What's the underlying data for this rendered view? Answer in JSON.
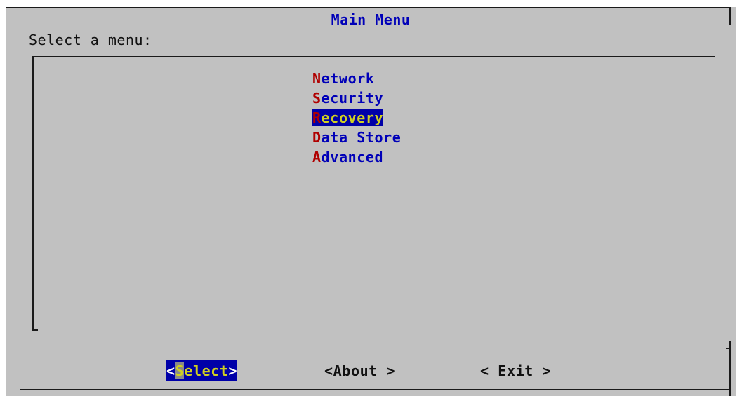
{
  "dialog": {
    "title": "Main Menu",
    "prompt": "Select a menu:"
  },
  "menu": {
    "items": [
      {
        "hotkey": "N",
        "rest": "etwork"
      },
      {
        "hotkey": "S",
        "rest": "ecurity"
      },
      {
        "hotkey": "R",
        "rest": "ecovery"
      },
      {
        "hotkey": "D",
        "rest": "ata Store"
      },
      {
        "hotkey": "A",
        "rest": "dvanced"
      }
    ],
    "selected_item": "Recovery"
  },
  "buttons": {
    "select": {
      "left": "<",
      "hotkey": "S",
      "rest": "elect",
      "right": ">"
    },
    "about": {
      "left": "<",
      "label": "About ",
      "right": ">"
    },
    "exit": {
      "left": "< ",
      "label": "Exit ",
      "right": ">"
    }
  },
  "colors": {
    "dialog_bg": "#c1c1c1",
    "text_blue": "#0000b8",
    "hotkey_red": "#b00000",
    "highlight_bg": "#0000a8",
    "highlight_text": "#d0d020"
  }
}
